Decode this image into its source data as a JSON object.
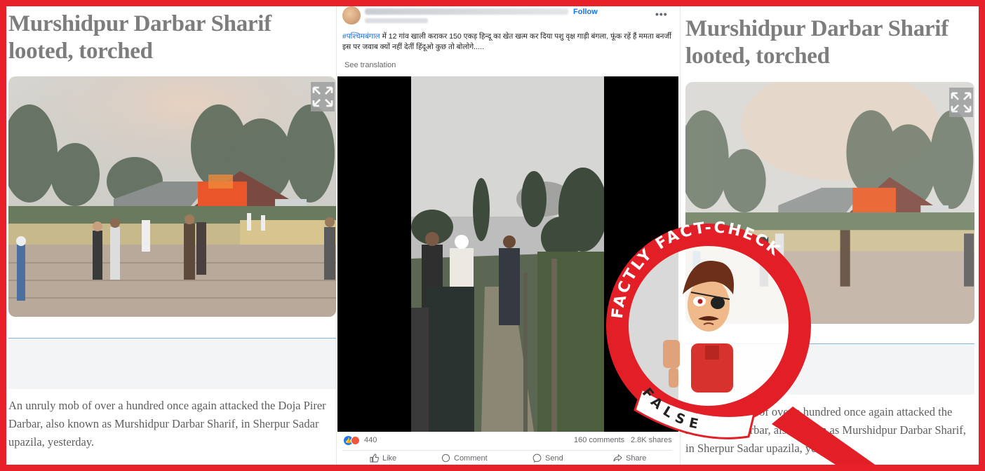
{
  "left_article": {
    "headline": "Murshidpur Darbar Sharif looted, torched",
    "body": "An unruly mob of over a hundred once again attacked the Doja Pirer Darbar, also known as Murshidpur Darbar Sharif, in Sherpur Sadar upazila, yesterday."
  },
  "right_article": {
    "headline": "Murshidpur Darbar Sharif looted, torched",
    "body": "An unruly mob of over a hundred once again attacked the Doja Pirer Darbar, also known as Murshidpur Darbar Sharif, in Sherpur Sadar upazila, yesterday."
  },
  "facebook_post": {
    "follow_label": "Follow",
    "more_label": "•••",
    "caption_hashtag": "#पश्चिमबंगाल",
    "caption_text": " में 12 गांव खाली कराकर 150 एकड़ हिन्दू का खेत खत्म कर दिया पशु वृक्ष गाड़ी बंगला, फूंक रहें हैं ममता बनर्जी इस पर जवाब क्यों नहीं देतीं हिंदूओ कुछ तो बोलोगे.....",
    "see_translation": "See translation",
    "reaction_count": "440",
    "comments": "160 comments",
    "shares": "2.8K shares",
    "actions": {
      "like": "Like",
      "comment": "Comment",
      "send": "Send",
      "share": "Share"
    }
  },
  "badge": {
    "brand_text": "FACTLY FACT-CHECK",
    "verdict": "FALSE"
  },
  "colors": {
    "frame": "#e8202a",
    "badge_red": "#e21f26",
    "fb_blue": "#1877f2"
  }
}
